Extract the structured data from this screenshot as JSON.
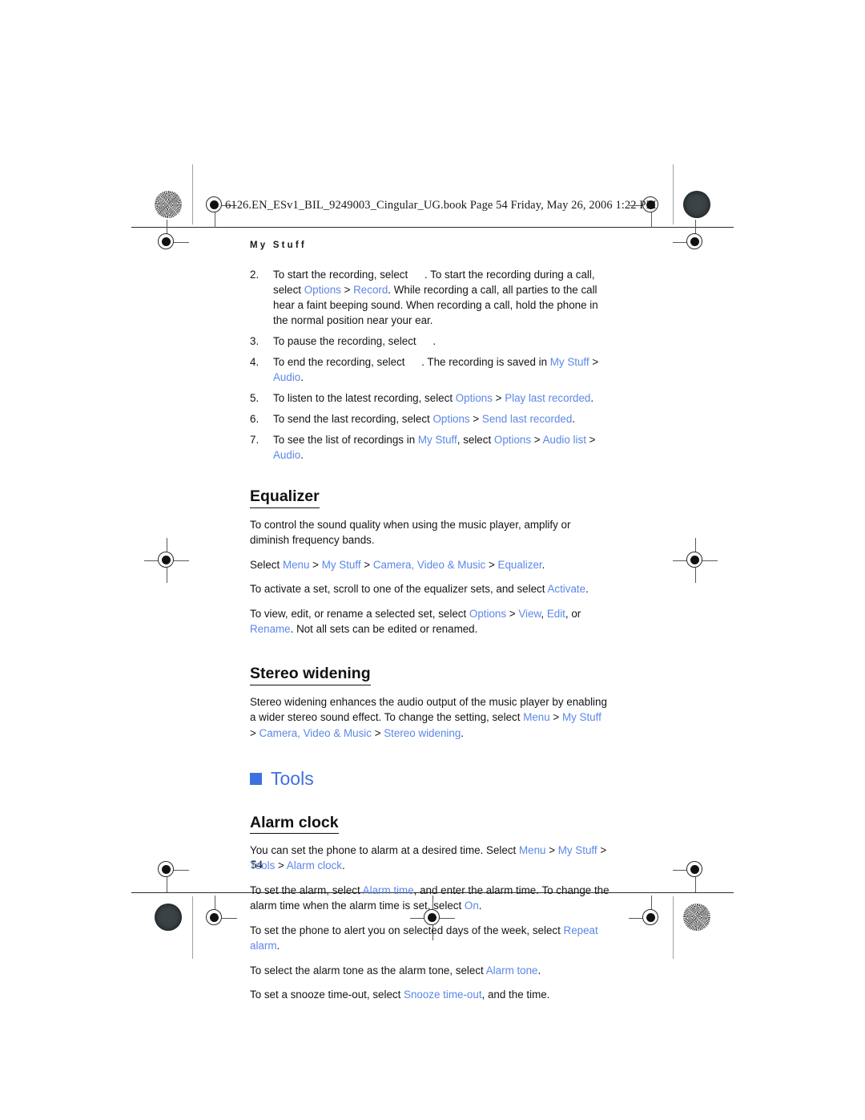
{
  "slugline": "6126.EN_ESv1_BIL_9249003_Cingular_UG.book  Page 54  Friday, May 26, 2006  1:22 PM",
  "running_head": "My Stuff",
  "folio": "54",
  "colors": {
    "link_blue": "#5b87e8",
    "chapter_blue": "#3f6fe0",
    "body_black": "#141414"
  },
  "steps": [
    {
      "number": "2.",
      "parts": [
        {
          "text": "To start the recording, select ",
          "style": "plain"
        },
        {
          "text": "",
          "style": "glyph-gap"
        },
        {
          "text": ". To start the recording during a call, select ",
          "style": "plain"
        },
        {
          "text": "Options",
          "style": "link"
        },
        {
          "text": " > ",
          "style": "plain"
        },
        {
          "text": "Record",
          "style": "link"
        },
        {
          "text": ". While recording a call, all parties to the call hear a faint beeping sound. When recording a call, hold the phone in the normal position near your ear.",
          "style": "plain"
        }
      ]
    },
    {
      "number": "3.",
      "parts": [
        {
          "text": "To pause the recording, select ",
          "style": "plain"
        },
        {
          "text": "",
          "style": "glyph-gap"
        },
        {
          "text": ".",
          "style": "plain"
        }
      ]
    },
    {
      "number": "4.",
      "parts": [
        {
          "text": "To end the recording, select ",
          "style": "plain"
        },
        {
          "text": "",
          "style": "glyph-gap"
        },
        {
          "text": ". The recording is saved in ",
          "style": "plain"
        },
        {
          "text": "My Stuff",
          "style": "link"
        },
        {
          "text": " > ",
          "style": "plain"
        },
        {
          "text": "Audio",
          "style": "link"
        },
        {
          "text": ".",
          "style": "plain"
        }
      ]
    },
    {
      "number": "5.",
      "parts": [
        {
          "text": "To listen to the latest recording, select ",
          "style": "plain"
        },
        {
          "text": "Options",
          "style": "link"
        },
        {
          "text": " > ",
          "style": "plain"
        },
        {
          "text": "Play last recorded",
          "style": "link"
        },
        {
          "text": ".",
          "style": "plain"
        }
      ]
    },
    {
      "number": "6.",
      "parts": [
        {
          "text": "To send the last recording, select ",
          "style": "plain"
        },
        {
          "text": "Options",
          "style": "link"
        },
        {
          "text": " > ",
          "style": "plain"
        },
        {
          "text": "Send last recorded",
          "style": "link"
        },
        {
          "text": ".",
          "style": "plain"
        }
      ]
    },
    {
      "number": "7.",
      "parts": [
        {
          "text": "To see the list of recordings in ",
          "style": "plain"
        },
        {
          "text": "My Stuff",
          "style": "link"
        },
        {
          "text": ", select ",
          "style": "plain"
        },
        {
          "text": "Options",
          "style": "link"
        },
        {
          "text": " > ",
          "style": "plain"
        },
        {
          "text": "Audio list",
          "style": "link"
        },
        {
          "text": " > ",
          "style": "plain"
        },
        {
          "text": "Audio",
          "style": "link"
        },
        {
          "text": ".",
          "style": "plain"
        }
      ]
    }
  ],
  "equalizer": {
    "heading": "Equalizer",
    "paragraphs": [
      [
        {
          "text": "To control the sound quality when using the music player, amplify or diminish frequency bands.",
          "style": "plain"
        }
      ],
      [
        {
          "text": "Select ",
          "style": "plain"
        },
        {
          "text": "Menu",
          "style": "link"
        },
        {
          "text": " > ",
          "style": "plain"
        },
        {
          "text": "My Stuff",
          "style": "link"
        },
        {
          "text": " > ",
          "style": "plain"
        },
        {
          "text": "Camera, Video & Music",
          "style": "link"
        },
        {
          "text": " > ",
          "style": "plain"
        },
        {
          "text": "Equalizer",
          "style": "link"
        },
        {
          "text": ".",
          "style": "plain"
        }
      ],
      [
        {
          "text": "To activate a set, scroll to one of the equalizer sets, and select ",
          "style": "plain"
        },
        {
          "text": "Activate",
          "style": "link"
        },
        {
          "text": ".",
          "style": "plain"
        }
      ],
      [
        {
          "text": "To view, edit, or rename a selected set, select ",
          "style": "plain"
        },
        {
          "text": "Options",
          "style": "link"
        },
        {
          "text": " > ",
          "style": "plain"
        },
        {
          "text": "View",
          "style": "link"
        },
        {
          "text": ", ",
          "style": "plain"
        },
        {
          "text": "Edit",
          "style": "link"
        },
        {
          "text": ", or ",
          "style": "plain"
        },
        {
          "text": "Rename",
          "style": "link"
        },
        {
          "text": ". Not all sets can be edited or renamed.",
          "style": "plain"
        }
      ]
    ]
  },
  "stereo_widening": {
    "heading": "Stereo widening",
    "paragraphs": [
      [
        {
          "text": "Stereo widening enhances the audio output of the music player by enabling a wider stereo sound effect. To change the setting, select ",
          "style": "plain"
        },
        {
          "text": "Menu",
          "style": "link"
        },
        {
          "text": " > ",
          "style": "plain"
        },
        {
          "text": "My Stuff",
          "style": "link"
        },
        {
          "text": " > ",
          "style": "plain"
        },
        {
          "text": "Camera, Video & Music",
          "style": "link"
        },
        {
          "text": " > ",
          "style": "plain"
        },
        {
          "text": "Stereo widening",
          "style": "link"
        },
        {
          "text": ".",
          "style": "plain"
        }
      ]
    ]
  },
  "tools": {
    "heading": "Tools",
    "bullet_icon": "square-bullet-icon"
  },
  "alarm_clock": {
    "heading": "Alarm clock",
    "paragraphs": [
      [
        {
          "text": "You can set the phone to alarm at a desired time. Select ",
          "style": "plain"
        },
        {
          "text": "Menu",
          "style": "link"
        },
        {
          "text": " > ",
          "style": "plain"
        },
        {
          "text": "My Stuff",
          "style": "link"
        },
        {
          "text": " > ",
          "style": "plain"
        },
        {
          "text": "Tools",
          "style": "link"
        },
        {
          "text": " > ",
          "style": "plain"
        },
        {
          "text": "Alarm clock",
          "style": "link"
        },
        {
          "text": ".",
          "style": "plain"
        }
      ],
      [
        {
          "text": "To set the alarm, select ",
          "style": "plain"
        },
        {
          "text": "Alarm time",
          "style": "link"
        },
        {
          "text": ", and enter the alarm time. To change the alarm time when the alarm time is set, select ",
          "style": "plain"
        },
        {
          "text": "On",
          "style": "link"
        },
        {
          "text": ".",
          "style": "plain"
        }
      ],
      [
        {
          "text": "To set the phone to alert you on selected days of the week, select ",
          "style": "plain"
        },
        {
          "text": "Repeat alarm",
          "style": "link"
        },
        {
          "text": ".",
          "style": "plain"
        }
      ],
      [
        {
          "text": "To select the alarm tone as the alarm tone, select ",
          "style": "plain"
        },
        {
          "text": "Alarm tone",
          "style": "link"
        },
        {
          "text": ".",
          "style": "plain"
        }
      ],
      [
        {
          "text": "To set a snooze time-out, select ",
          "style": "plain"
        },
        {
          "text": "Snooze time-out",
          "style": "link"
        },
        {
          "text": ", and the time.",
          "style": "plain"
        }
      ]
    ]
  }
}
